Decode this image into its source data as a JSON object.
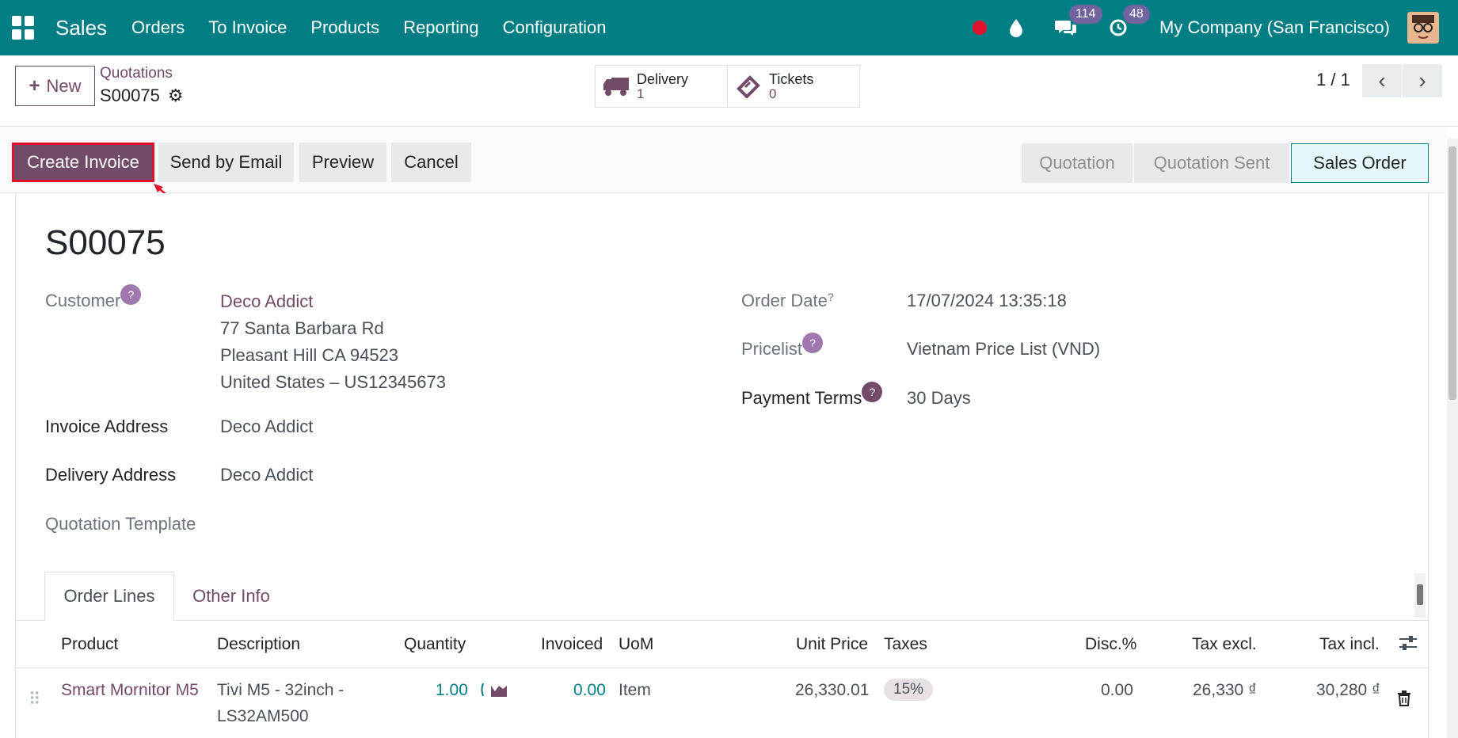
{
  "navbar": {
    "app_name": "Sales",
    "menu": [
      "Orders",
      "To Invoice",
      "Products",
      "Reporting",
      "Configuration"
    ],
    "messages_count": "114",
    "activities_count": "48",
    "company": "My Company (San Francisco)",
    "accent_color": "#017e84"
  },
  "control_panel": {
    "new_label": "New",
    "breadcrumb_parent": "Quotations",
    "breadcrumb_current": "S00075",
    "smart_buttons": [
      {
        "label": "Delivery",
        "value": "1",
        "icon": "truck-icon"
      },
      {
        "label": "Tickets",
        "value": "0",
        "icon": "ticket-icon"
      }
    ],
    "pager": "1 / 1"
  },
  "actions": {
    "create_invoice": "Create Invoice",
    "send_by_email": "Send by Email",
    "preview": "Preview",
    "cancel": "Cancel"
  },
  "status": {
    "stages": [
      "Quotation",
      "Quotation Sent",
      "Sales Order"
    ],
    "active": "Sales Order"
  },
  "form": {
    "title": "S00075",
    "customer_label": "Customer",
    "customer_name": "Deco Addict",
    "address_line1": "77 Santa Barbara Rd",
    "address_line2": "Pleasant Hill CA 94523",
    "address_line3": "United States – US12345673",
    "invoice_address_label": "Invoice Address",
    "invoice_address": "Deco Addict",
    "delivery_address_label": "Delivery Address",
    "delivery_address": "Deco Addict",
    "quotation_template_label": "Quotation Template",
    "order_date_label": "Order Date",
    "order_date": "17/07/2024 13:35:18",
    "pricelist_label": "Pricelist",
    "pricelist": "Vietnam Price List (VND)",
    "payment_terms_label": "Payment Terms",
    "payment_terms": "30 Days",
    "help_mark": "?"
  },
  "tabs": [
    "Order Lines",
    "Other Info"
  ],
  "order_lines": {
    "columns": [
      "Product",
      "Description",
      "Quantity",
      "Invoiced",
      "UoM",
      "Unit Price",
      "Taxes",
      "Disc.%",
      "Tax excl.",
      "Tax incl."
    ],
    "rows": [
      {
        "product": "Smart Mornitor M5",
        "description_line1": "Tivi M5 - 32inch -",
        "description_line2": "LS32AM500",
        "quantity": "1.00",
        "invoiced": "0.00",
        "uom": "Item",
        "unit_price": "26,330.01",
        "taxes": "15%",
        "discount": "0.00",
        "tax_excl": "26,330 ₫",
        "tax_incl": "30,280 ₫"
      }
    ]
  }
}
